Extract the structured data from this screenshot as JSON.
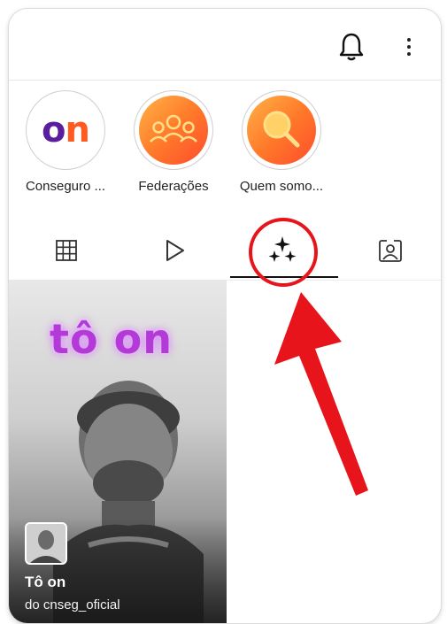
{
  "topbar": {
    "notifications_icon": "bell-icon",
    "menu_icon": "more-vertical-icon"
  },
  "highlights": [
    {
      "label": "Conseguro ...",
      "cover": "on-logo"
    },
    {
      "label": "Federações",
      "cover": "people-icon"
    },
    {
      "label": "Quem somo...",
      "cover": "magnifier-icon"
    }
  ],
  "on_logo": {
    "o": "o",
    "n": "n"
  },
  "tabs": [
    {
      "name": "posts",
      "icon": "grid-icon",
      "active": false
    },
    {
      "name": "reels",
      "icon": "play-icon",
      "active": false
    },
    {
      "name": "guides",
      "icon": "sparkles-icon",
      "active": true
    },
    {
      "name": "tagged",
      "icon": "tagged-person-icon",
      "active": false
    }
  ],
  "reel": {
    "overlay_text": "tô on",
    "title": "Tô on",
    "byline": "do cnseg_oficial"
  },
  "colors": {
    "annotation_red": "#e8141c",
    "brand_purple": "#5a1d9e",
    "brand_orange": "#ff5a1f"
  }
}
